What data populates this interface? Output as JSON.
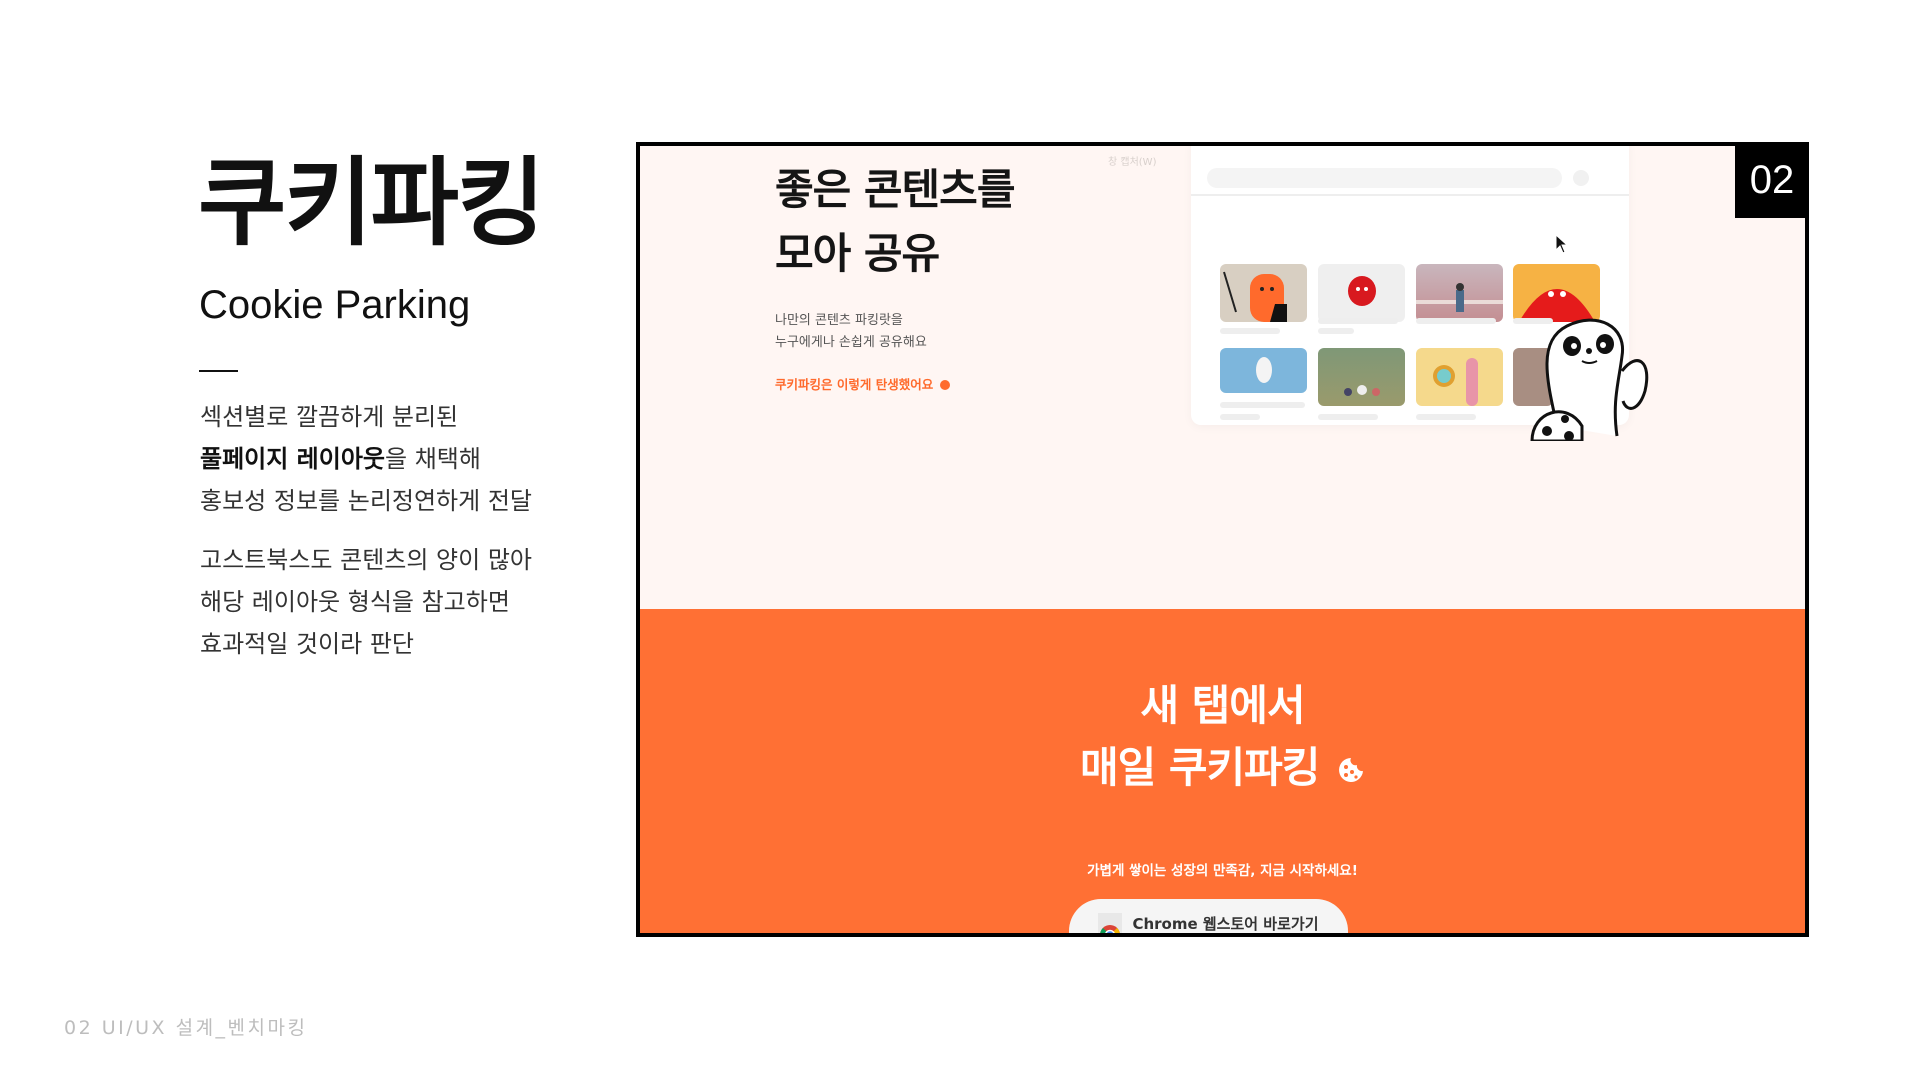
{
  "slide": {
    "title_ko": "쿠키파킹",
    "title_en": "Cookie Parking",
    "paragraph1": {
      "line1": "섹션별로 깔끔하게 분리된",
      "line2_bold": "풀페이지 레이아웃",
      "line2_rest": "을 채택해",
      "line3": "홍보성 정보를 논리정연하게 전달"
    },
    "paragraph2": {
      "line1": "고스트북스도 콘텐츠의 양이 많아",
      "line2": "해당 레이아웃 형식을 참고하면",
      "line3": "효과적일 것이라 판단"
    },
    "footer": "02 UI/UX 설계_벤치마킹",
    "badge": "02"
  },
  "screenshot": {
    "hero": {
      "heading_line1": "좋은 콘텐츠를",
      "heading_line2": "모아 공유",
      "sub_line1": "나만의 콘텐츠 파킹랏을",
      "sub_line2": "누구에게나 손쉽게 공유해요",
      "link": "쿠키파킹은 이렇게 탄생했어요",
      "tab_caption": "창 캡처(W)"
    },
    "cta": {
      "heading_line1": "새 탭에서",
      "heading_line2": "매일 쿠키파킹",
      "subtitle": "가볍게 쌓이는 성장의 만족감, 지금 시작하세요!",
      "button": "Chrome 웹스토어 바로가기"
    },
    "colors": {
      "accent": "#ff7034",
      "hero_bg": "#fff6f3",
      "frame": "#000000"
    },
    "icons": [
      "cookie-icon",
      "chrome-icon",
      "cursor-icon",
      "mascot-illustration"
    ]
  }
}
